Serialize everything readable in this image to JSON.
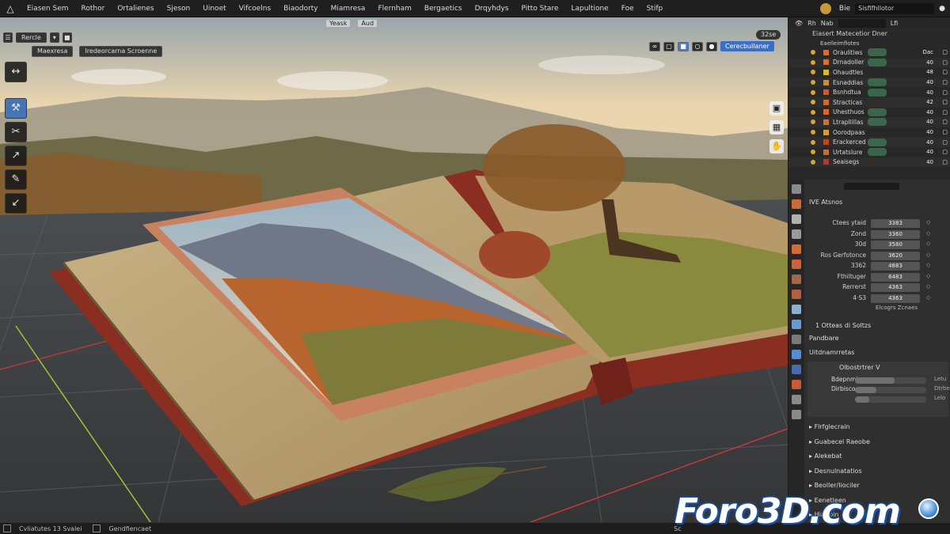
{
  "menubar": {
    "items": [
      "Eiasen Sem",
      "Rothor",
      "Ortalienes",
      "Sjeson",
      "Uinoet",
      "Vifcoelns",
      "Biaodorty",
      "Miamresa",
      "Flernham",
      "Bergaetics",
      "Drqyhdys",
      "Pitto Stare",
      "Lapultione",
      "Foe",
      "Stifp"
    ],
    "right_label": "Bie",
    "search_text": "Sisfifhllotor"
  },
  "viewport": {
    "header_buttons": [
      "Rercle"
    ],
    "labels": [
      "Maexresa",
      "Iredeorcarna Scroenne"
    ],
    "top_center": [
      "Yeask",
      "Aud"
    ],
    "overlay_button": "Cerecbullaner",
    "top_right_chip": "32se",
    "tools": [
      "↔",
      "⚒",
      "✂",
      "↗",
      "✎",
      "↙"
    ]
  },
  "panel_header": {
    "items": [
      "Rh",
      "Nab",
      "Lfi"
    ]
  },
  "outliner": {
    "title": "Eiasert Matecetior Dner",
    "subtitle": "Eaelleimfiotes",
    "rows": [
      {
        "name": "Oraulitiws",
        "tag": "Dac",
        "color": "#e8652a"
      },
      {
        "name": "Drnadoller",
        "tag": "40",
        "color": "#e06b2e"
      },
      {
        "name": "Ohaudtles",
        "tag": "48",
        "color": "#d4b83a"
      },
      {
        "name": "Esnaddias",
        "tag": "40",
        "color": "#d28a3a"
      },
      {
        "name": "Bsnhdtua",
        "tag": "40",
        "color": "#c85a32"
      },
      {
        "name": "Stracticas",
        "tag": "42",
        "color": "#cc6a35"
      },
      {
        "name": "Uhesthuos",
        "tag": "40",
        "color": "#d66632"
      },
      {
        "name": "Ltrapllillas",
        "tag": "40",
        "color": "#cf7238"
      },
      {
        "name": "Oorodpaas",
        "tag": "40",
        "color": "#d39a3e"
      },
      {
        "name": "Erackerced",
        "tag": "40",
        "color": "#b8452c"
      },
      {
        "name": "Urtatslure",
        "tag": "40",
        "color": "#c96a3a"
      },
      {
        "name": "Seaisegs",
        "tag": "40",
        "color": "#b13a2c"
      }
    ]
  },
  "props": {
    "title": "IVE Atsnos",
    "fields": [
      {
        "label": "Ctees ytaid",
        "value": "3383"
      },
      {
        "label": "Zond",
        "value": "3360"
      },
      {
        "label": "30d",
        "value": "3580"
      },
      {
        "label": "Ros Gerfotonce",
        "value": "3620"
      },
      {
        "label": "3362",
        "value": "4883"
      },
      {
        "label": "Fthiltuger",
        "value": "6483"
      },
      {
        "label": "Rerrerst",
        "value": "4363"
      },
      {
        "label": "4·S3",
        "value": "4363"
      }
    ],
    "fields_caption": "Elcogrs Zcnaes",
    "section_a": "1 Otteas di Soltzs",
    "section_b": "Pandbare",
    "section_c": "Uitdnamrretas",
    "subpanel": {
      "title": "Olbostrtrer V",
      "rows": [
        {
          "label": "Bdepnmiouss",
          "fill": 0.55,
          "val": "Letu"
        },
        {
          "label": "Dirbiscoes",
          "fill": 0.3,
          "val": "Dtrbe"
        },
        {
          "label": "",
          "fill": 0.2,
          "val": "Lelo"
        }
      ]
    },
    "collapsibles": [
      "Flrfglecrain",
      "Guabecel Raeobe",
      "Alekebat",
      "Desnulnatatios",
      "Beoller/Iiociler",
      "Eenetleen",
      "Hiaribin"
    ]
  },
  "statusbar": {
    "items": [
      "Cvliatutes 13 Svalei",
      "Gendfiencaet"
    ],
    "right": "Sc"
  },
  "watermark": {
    "text": "Foro3D.com"
  },
  "colors": {
    "accent": "#4774b5",
    "panel_bg": "#303030",
    "header_bg": "#1f1f1f"
  }
}
